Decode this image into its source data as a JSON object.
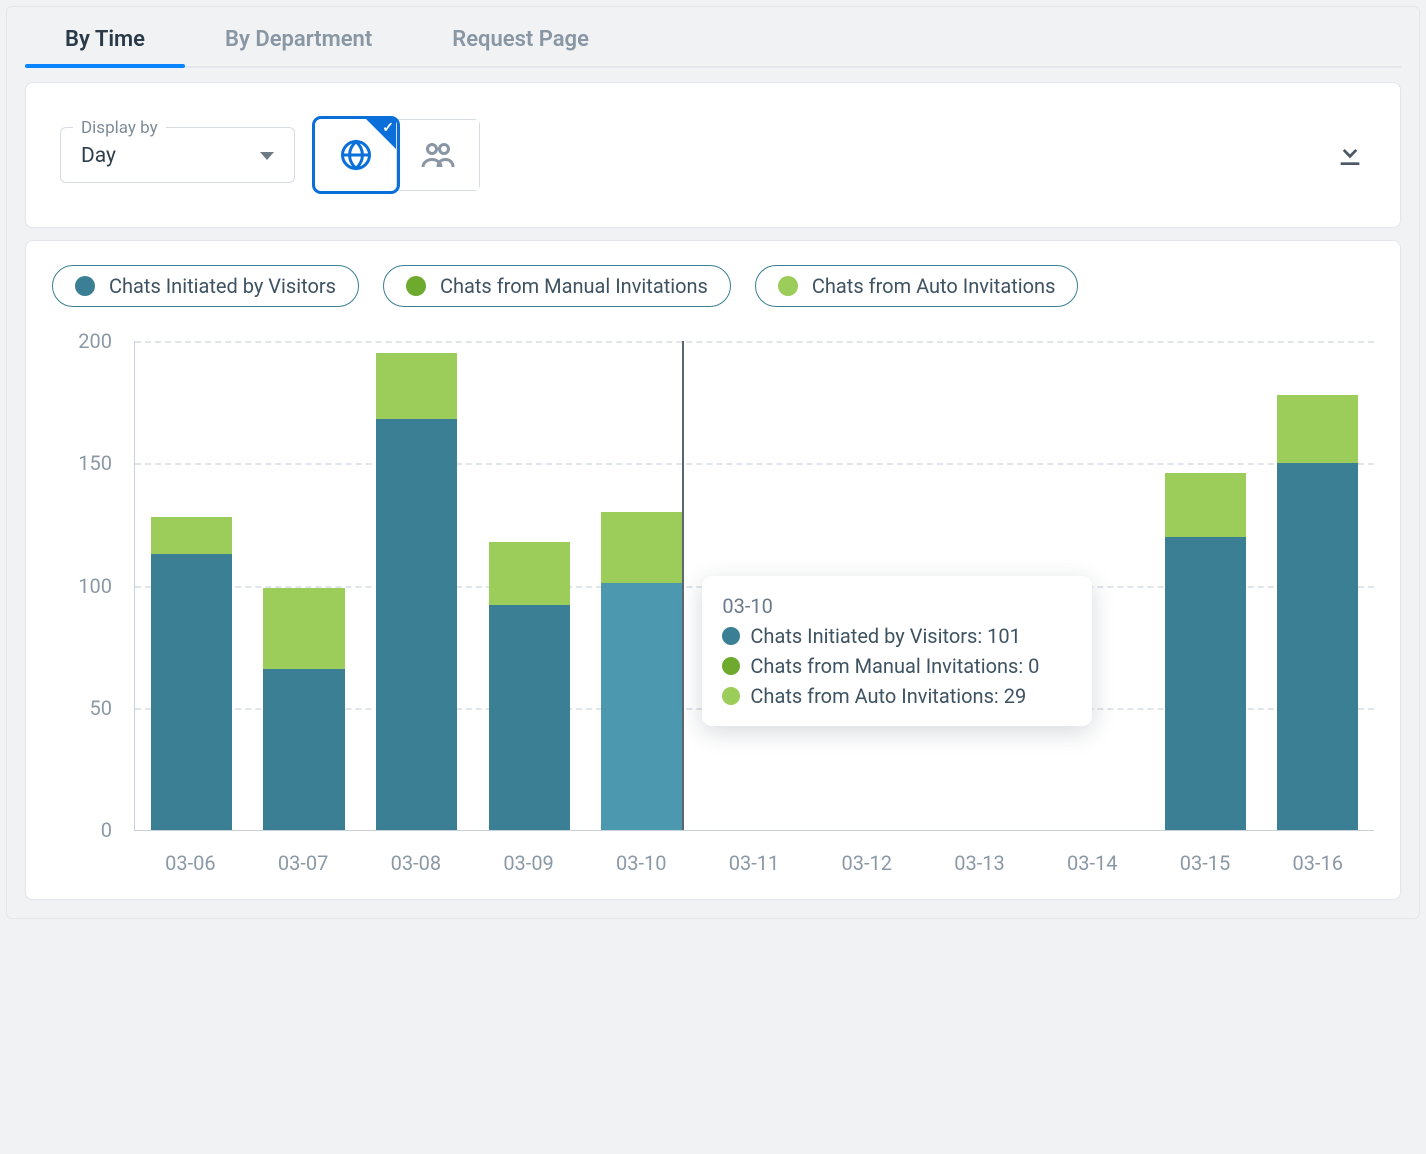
{
  "tabs": [
    {
      "label": "By Time",
      "active": true
    },
    {
      "label": "By Department",
      "active": false
    },
    {
      "label": "Request Page",
      "active": false
    }
  ],
  "controls": {
    "display_by_label": "Display by",
    "display_by_value": "Day",
    "view_mode": "global",
    "download_icon": "download-icon"
  },
  "colors": {
    "visitors": "#3b7f94",
    "visitors_hover": "#4b98af",
    "manual": "#6eaa2e",
    "auto": "#9ccc5a"
  },
  "legend": [
    {
      "key": "visitors",
      "label": "Chats Initiated by Visitors",
      "color": "#3b7f94"
    },
    {
      "key": "manual",
      "label": "Chats from Manual Invitations",
      "color": "#6eaa2e"
    },
    {
      "key": "auto",
      "label": "Chats from Auto Invitations",
      "color": "#9ccc5a"
    }
  ],
  "chart_data": {
    "type": "bar",
    "stacked": true,
    "ylabel": "",
    "xlabel": "",
    "ylim": [
      0,
      200
    ],
    "y_ticks": [
      0,
      50,
      100,
      150,
      200
    ],
    "categories": [
      "03-06",
      "03-07",
      "03-08",
      "03-09",
      "03-10",
      "03-11",
      "03-12",
      "03-13",
      "03-14",
      "03-15",
      "03-16"
    ],
    "series": [
      {
        "name": "Chats Initiated by Visitors",
        "key": "visitors",
        "color": "#3b7f94",
        "values": [
          113,
          66,
          168,
          92,
          101,
          0,
          0,
          0,
          0,
          120,
          150
        ]
      },
      {
        "name": "Chats from Manual Invitations",
        "key": "manual",
        "color": "#6eaa2e",
        "values": [
          0,
          0,
          0,
          0,
          0,
          0,
          0,
          0,
          0,
          0,
          0
        ]
      },
      {
        "name": "Chats from Auto Invitations",
        "key": "auto",
        "color": "#9ccc5a",
        "values": [
          15,
          33,
          27,
          26,
          29,
          0,
          0,
          0,
          0,
          26,
          28
        ]
      }
    ],
    "hover_index": 4,
    "tooltip": {
      "title": "03-10",
      "rows": [
        {
          "color": "#3b7f94",
          "label": "Chats Initiated by Visitors",
          "value": 101
        },
        {
          "color": "#6eaa2e",
          "label": "Chats from Manual Invitations",
          "value": 0
        },
        {
          "color": "#9ccc5a",
          "label": "Chats from Auto Invitations",
          "value": 29
        }
      ]
    }
  }
}
